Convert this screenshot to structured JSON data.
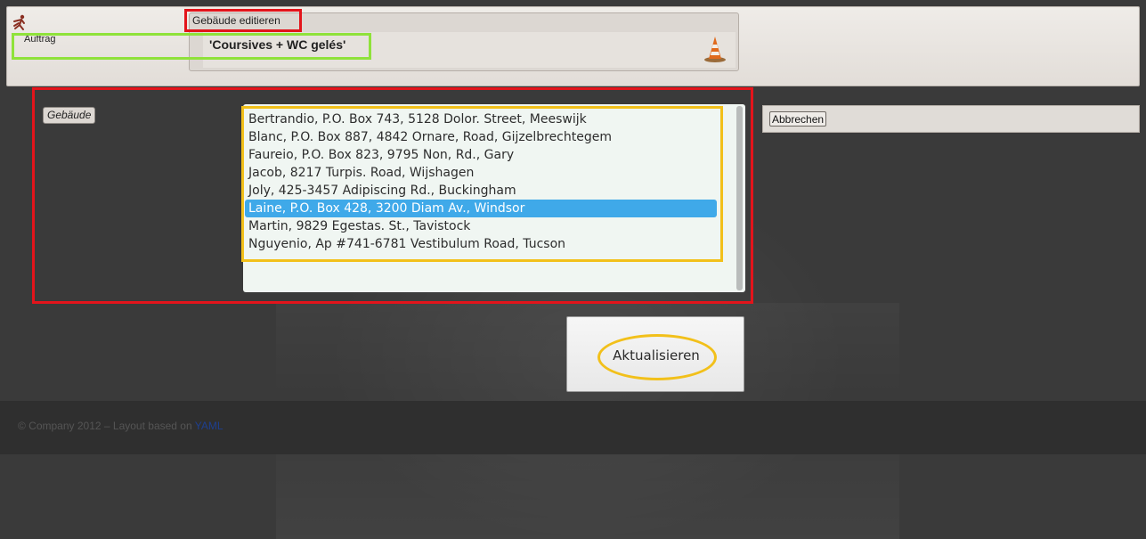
{
  "header": {
    "section_label": "Auftrag",
    "panel_title": "Gebäude editieren",
    "order_name": "'Coursives + WC gelés'"
  },
  "form": {
    "field_label": "Gebäude",
    "buildings": [
      "Bertrandio, P.O. Box 743, 5128 Dolor. Street, Meeswijk",
      "Blanc, P.O. Box 887, 4842 Ornare, Road, Gijzelbrechtegem",
      "Faureio, P.O. Box 823, 9795 Non, Rd., Gary",
      "Jacob, 8217 Turpis. Road, Wijshagen",
      "Joly, 425-3457 Adipiscing Rd., Buckingham",
      "Laine, P.O. Box 428, 3200 Diam Av., Windsor",
      "Martin, 9829 Egestas. St., Tavistock",
      "Nguyenio, Ap #741-6781 Vestibulum Road, Tucson"
    ],
    "selected_building": "Laine, P.O. Box 428, 3200 Diam Av., Windsor",
    "cancel_label": "Abbrechen",
    "update_label": "Aktualisieren"
  },
  "footer": {
    "text": "© Company 2012 – Layout based on",
    "link": "YAML"
  },
  "colors": {
    "selection": "#3fa9e9",
    "annotation_red": "#e3141b",
    "annotation_green": "#8fe23a",
    "annotation_yellow": "#f2c01a"
  }
}
